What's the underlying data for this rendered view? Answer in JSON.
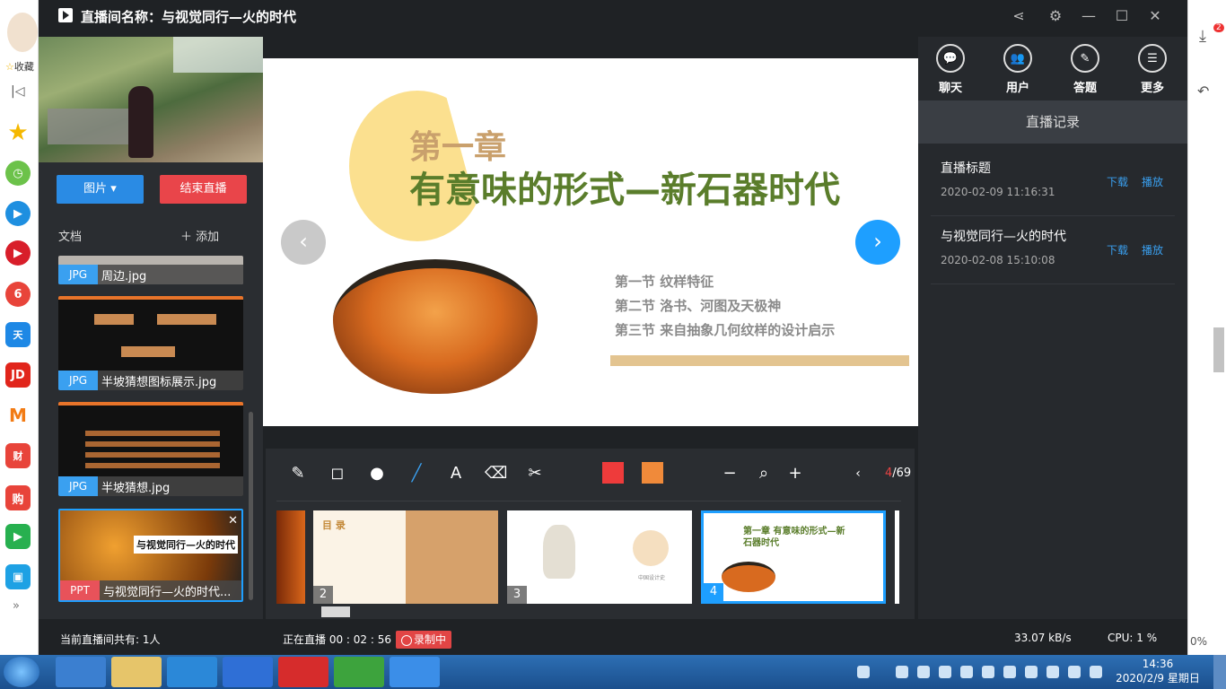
{
  "window": {
    "title": "直播间名称：与视觉同行—火的时代"
  },
  "browser_strip": {
    "favorite_label": "收藏"
  },
  "left_panel": {
    "image_button": "图片",
    "end_button": "结束直播",
    "doc_label": "文档",
    "add_label": "添加",
    "documents": [
      {
        "type": "JPG",
        "name": "周边.jpg"
      },
      {
        "type": "JPG",
        "name": "半坡猜想图标展示.jpg"
      },
      {
        "type": "JPG",
        "name": "半坡猜想.jpg"
      },
      {
        "type": "PPT",
        "name": "与视觉同行—火的时代...",
        "thumb_text": "与视觉同行—火的时代"
      }
    ]
  },
  "slide": {
    "chapter": "第一章",
    "subtitle": "有意味的形式—新石器时代",
    "sections": [
      "第一节  纹样特征",
      "第二节  洛书、河图及天极神",
      "第三节  来自抽象几何纹样的设计启示"
    ]
  },
  "toolbar": {
    "page_current": "4",
    "page_total": "/69",
    "colors": {
      "red": "#ee3b3b",
      "orange": "#f08a3a"
    }
  },
  "thumbnails": [
    {
      "num": "2",
      "label": "目 录"
    },
    {
      "num": "3",
      "label": "中国设计史"
    },
    {
      "num": "4",
      "label": "第一章 有意味的形式—新石器时代"
    }
  ],
  "right_panel": {
    "tabs": [
      "聊天",
      "用户",
      "答题",
      "更多"
    ],
    "record_header": "直播记录",
    "records": [
      {
        "title": "直播标题",
        "date": "2020-02-09 11:16:31",
        "download": "下载",
        "play": "播放"
      },
      {
        "title": "与视觉同行—火的时代",
        "date": "2020-02-08 15:10:08",
        "download": "下载",
        "play": "播放"
      }
    ]
  },
  "status": {
    "viewers": "当前直播间共有: 1人",
    "live_time": "正在直播 00 : 02 : 56",
    "recording": "录制中",
    "speed": "33.07 kB/s",
    "cpu": "CPU:  1 %"
  },
  "taskbar": {
    "time": "14:36",
    "date": "2020/2/9 星期日"
  },
  "right_edge": {
    "badge": "2",
    "zoom": "0%"
  }
}
